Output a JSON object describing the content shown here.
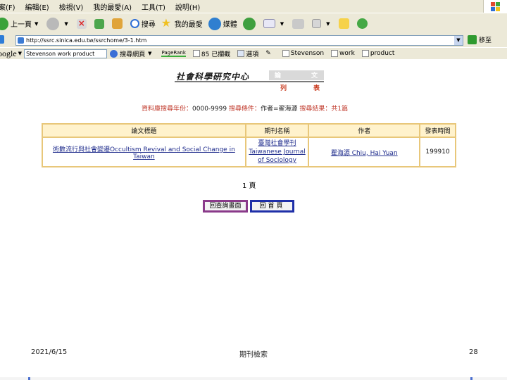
{
  "browser": {
    "menu": [
      "案(F)",
      "編輯(E)",
      "檢視(V)",
      "我的最愛(A)",
      "工具(T)",
      "說明(H)"
    ],
    "toolbar": {
      "back_label": "上一頁",
      "search_label": "搜尋",
      "favorites_label": "我的最愛",
      "media_label": "媒體"
    },
    "address": {
      "url": "http://ssrc.sinica.edu.tw/ssrchome/3-1.htm",
      "go_label": "移至"
    },
    "google_bar": {
      "logo": "oogle",
      "search_value": "Stevenson work product",
      "search_web_label": "搜尋網頁",
      "pagerank_label": "PageRank",
      "blocked_label": "85 已攔截",
      "options_label": "選項",
      "highlights": [
        "Stevenson",
        "work",
        "product"
      ]
    }
  },
  "page": {
    "logo": {
      "center_name": "社會科學研究中心",
      "tab_left": "論",
      "tab_right": "文",
      "sub_left": "列",
      "sub_right": "表"
    },
    "query": {
      "year_label": "資料庫搜尋年份：",
      "year_value": "0000-9999",
      "condition_label": "搜尋條件：",
      "condition_value": "作者=翟海源",
      "result_label": "搜尋結果：",
      "result_value": "共1篇"
    },
    "table": {
      "headers": [
        "論文標題",
        "期刊名稱",
        "作者",
        "發表時間"
      ],
      "rows": [
        {
          "title": "術數流行與社會變遷Occultism Revival and Social Change in Taiwan",
          "journal_cn": "臺灣社會學刊",
          "journal_en": "Taiwanese Journal of Sociology",
          "author": "瞿海源 Chiu, Hai Yuan",
          "date": "199910"
        }
      ]
    },
    "pager": "1 頁",
    "back_button": "回查詢畫面",
    "home_button": "回首頁"
  },
  "slide_footer": {
    "date": "2021/6/15",
    "center": "期刊檢索",
    "page_number": "28"
  }
}
